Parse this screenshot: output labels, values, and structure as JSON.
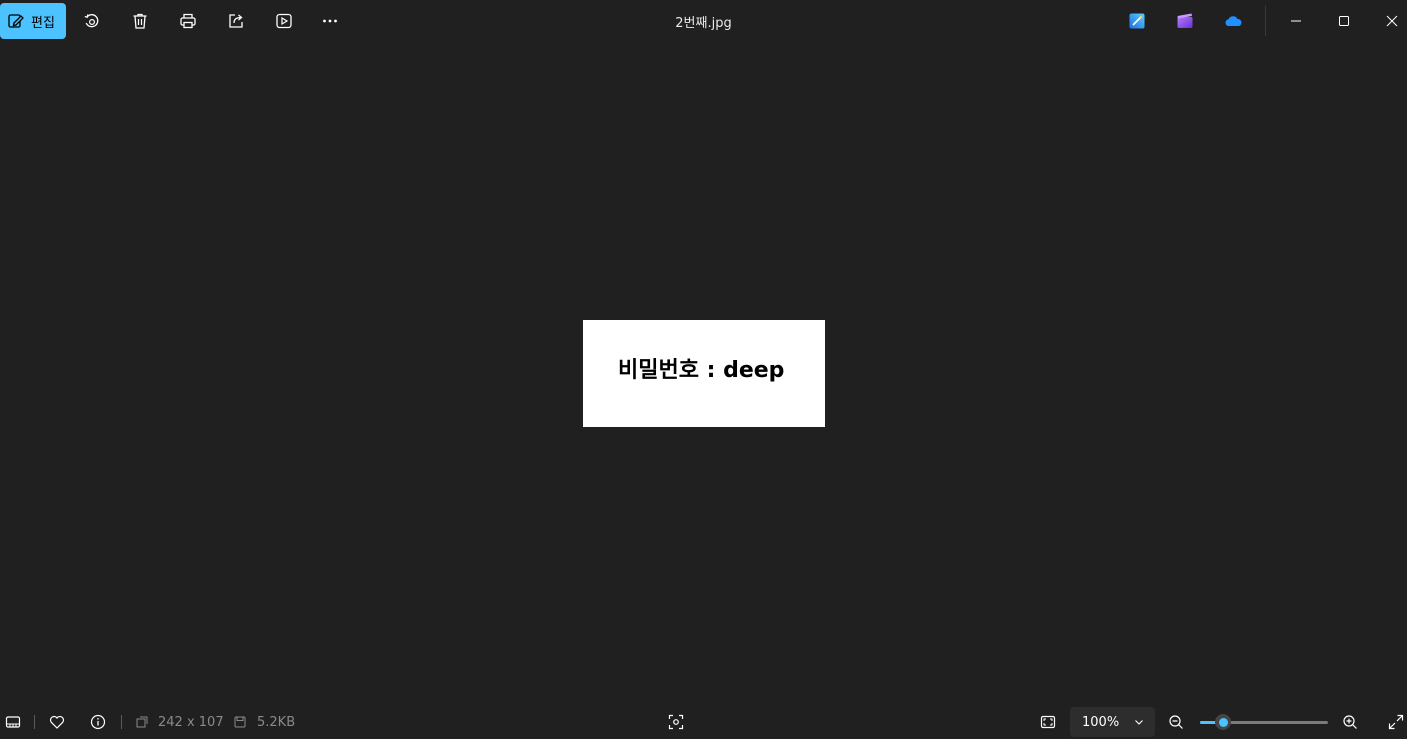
{
  "toolbar": {
    "edit_label": "편집",
    "icons": [
      "edit-pencil-icon",
      "rotate-icon",
      "delete-icon",
      "print-icon",
      "share-icon",
      "slideshow-icon",
      "more-icon"
    ]
  },
  "window": {
    "title": "2번째.jpg",
    "apps": [
      "designer-icon",
      "clipchamp-icon",
      "onedrive-icon"
    ]
  },
  "image": {
    "content_text": "비밀번호 : deep"
  },
  "status": {
    "dimensions": "242 x 107",
    "file_size": "5.2KB",
    "zoom": "100%",
    "zoom_level": 0.18
  },
  "colors": {
    "accent": "#4cc2ff",
    "background": "#202020"
  }
}
